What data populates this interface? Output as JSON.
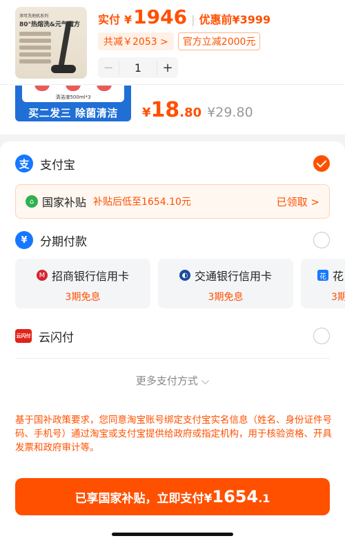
{
  "product": {
    "thumb_badge": "添可洗地机系列",
    "thumb_headline": "80°热熔洗&元气魔方",
    "pay_label": "实付",
    "currency": "¥",
    "pay_amount": "1946",
    "before_label": "优惠前",
    "before_amount": "¥3999",
    "discount_tag": "共减￥2053 >",
    "official_tag": "官方立减2000元",
    "quantity": "1",
    "minus": "−",
    "plus": "+"
  },
  "promo": {
    "cap_text": "清洁液500ml*3",
    "label": "买二发三 除菌清洁",
    "yen": "¥",
    "price_int": "18",
    "price_dec": ".80",
    "orig_price": "¥29.80"
  },
  "payment": {
    "alipay_label": "支付宝",
    "subsidy": {
      "title": "国家补贴",
      "desc": "补贴后低至1654.10元",
      "status": "已领取 >"
    },
    "installment_label": "分期付款",
    "cards": [
      {
        "name": "招商银行信用卡",
        "sub": "3期免息"
      },
      {
        "name": "交通银行信用卡",
        "sub": "3期免息"
      },
      {
        "name": "花",
        "sub": "3期"
      }
    ],
    "unionpay_label": "云闪付",
    "unionpay_icon_text": "云闪付",
    "more_label": "更多支付方式 ⌵",
    "notice": "基于国补政策要求，您同意淘宝账号绑定支付宝实名信息（姓名、身份证件号码、手机号）通过淘宝或支付宝提供给政府或指定机构，用于核验资格、开具发票和政府审计等。",
    "cta_prefix": "已享国家补贴，立即支付",
    "cta_yen": "¥",
    "cta_int": "1654",
    "cta_dec": ".1"
  },
  "colors": {
    "accent": "#ff5000",
    "alipay": "#1677ff",
    "subsidy_green": "#2fb152",
    "promo_blue": "#1f6fd6"
  }
}
